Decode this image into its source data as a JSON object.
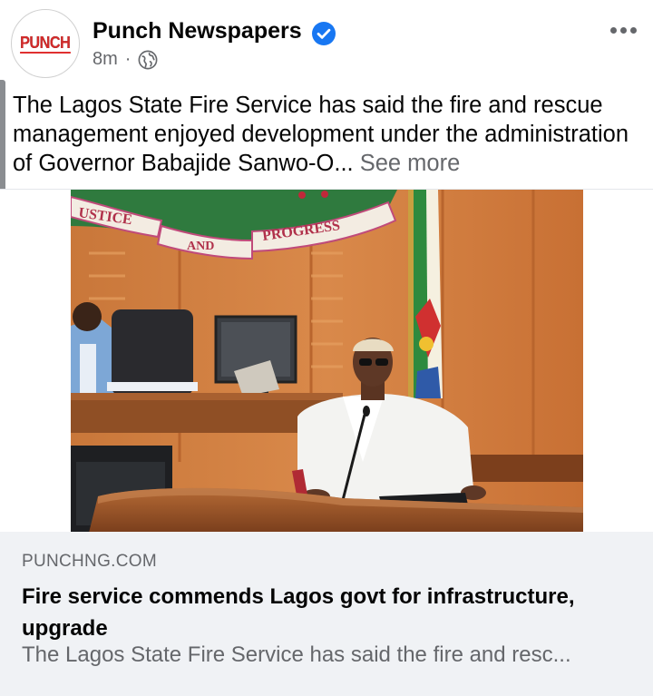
{
  "post": {
    "page_name": "Punch Newspapers",
    "logo_text": "PUNCH",
    "time_ago": "8m",
    "separator": "·",
    "audience_icon": "globe-icon",
    "verified_icon": "verified-badge-icon",
    "caption": "The Lagos State Fire Service has said the fire and rescue management enjoyed development under the administration of Governor Babajide Sanwo-O...",
    "see_more": "See more"
  },
  "photo": {
    "banner_words": [
      "USTICE",
      "AND",
      "PROGRESS"
    ]
  },
  "link_preview": {
    "domain": "PUNCHNG.COM",
    "title": "Fire service commends Lagos govt for infrastructure, upgrade",
    "description": "The Lagos State Fire Service has said the fire and resc..."
  },
  "colors": {
    "verified": "#1877f2",
    "secondary_text": "#65676b",
    "card_background": "#f0f2f5",
    "logo_red": "#d42a2a"
  }
}
